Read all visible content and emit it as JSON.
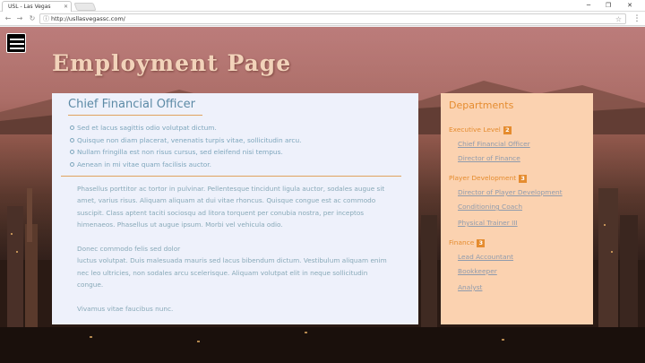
{
  "browser": {
    "tab_title": "USL - Las Vegas",
    "url": "http://usllasvegassc.com/"
  },
  "page": {
    "title": "Employment Page"
  },
  "job": {
    "title": "Chief Financial Officer",
    "bullets": [
      "Sed et lacus sagittis odio volutpat dictum.",
      "Quisque non diam placerat, venenatis turpis vitae, sollicitudin arcu.",
      "Nullam fringilla est non risus cursus, sed eleifend nisi tempus.",
      "Aenean in mi vitae quam facilisis auctor."
    ],
    "para1": [
      "Phasellus porttitor ac tortor in pulvinar. Pellentesque tincidunt ligula auctor, sodales augue sit",
      "amet, varius risus. Aliquam aliquam at dui vitae rhoncus. Quisque congue est ac commodo",
      "suscipit. Class aptent taciti sociosqu ad litora torquent per conubia nostra, per inceptos",
      "himenaeos. Phasellus ut augue ipsum. Morbi vel vehicula odio."
    ],
    "para2": [
      "Donec commodo felis sed dolor",
      "luctus volutpat. Duis malesuada mauris sed lacus bibendum dictum. Vestibulum aliquam enim",
      "nec leo ultricies, non sodales arcu scelerisque. Aliquam volutpat elit in neque sollicitudin",
      "congue."
    ],
    "para3": "Vivamus vitae faucibus nunc."
  },
  "sidebar": {
    "title": "Departments",
    "departments": [
      {
        "name": "Executive Level",
        "count": "2",
        "links": [
          "Chief Financial Officer",
          "Director of Finance"
        ]
      },
      {
        "name": "Player Development",
        "count": "3",
        "links": [
          "Director of Player Development",
          "Conditioning Coach",
          "Physical Trainer III"
        ]
      },
      {
        "name": "Finance",
        "count": "3",
        "links": [
          "Lead Accountant",
          "Bookkeeper",
          "Analyst"
        ]
      }
    ]
  },
  "colors": {
    "accent_orange": "#e58c2f",
    "title_blue": "#5c8aa6",
    "card_bg": "#eef1fb",
    "sidebar_bg": "#fbd2b0"
  }
}
